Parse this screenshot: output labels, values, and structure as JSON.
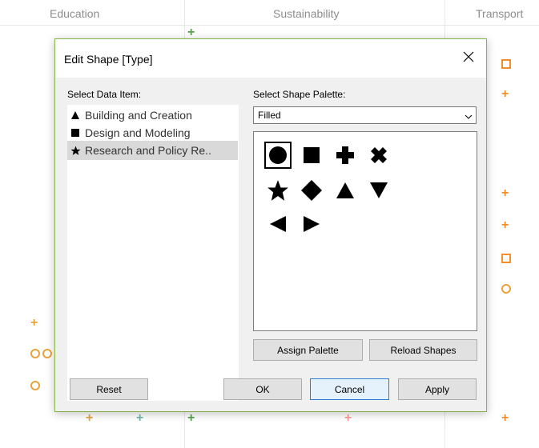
{
  "background": {
    "column_headers": [
      "Education",
      "Sustainability",
      "Transport"
    ]
  },
  "dialog": {
    "title": "Edit Shape [Type]",
    "select_data_item_label": "Select Data Item:",
    "select_palette_label": "Select Shape Palette:",
    "data_items": [
      {
        "icon": "triangle-icon",
        "label": "Building and Creation",
        "selected": false
      },
      {
        "icon": "square-icon",
        "label": "Design and Modeling",
        "selected": false
      },
      {
        "icon": "star-icon",
        "label": "Research and Policy Re..",
        "selected": true
      }
    ],
    "palette_value": "Filled",
    "shapes": [
      "circle",
      "square",
      "plus",
      "cross",
      "star",
      "diamond",
      "triangle-up",
      "triangle-down",
      "triangle-left",
      "triangle-right"
    ],
    "selected_shape": "circle",
    "buttons": {
      "assign_palette": "Assign Palette",
      "reload_shapes": "Reload Shapes",
      "reset": "Reset",
      "ok": "OK",
      "cancel": "Cancel",
      "apply": "Apply"
    }
  },
  "colors": {
    "green": "#59a14f",
    "orange": "#f28e2b",
    "teal": "#76b7b2",
    "pink": "#ff9d9a",
    "gold": "#e8a33b",
    "dialog_border": "#86b44a"
  }
}
